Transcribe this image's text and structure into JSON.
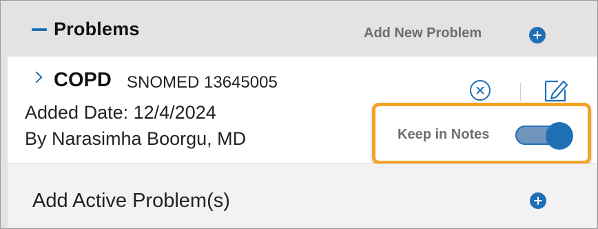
{
  "section": {
    "title": "Problems",
    "add_new_label": "Add New Problem"
  },
  "problem": {
    "name": "COPD",
    "code": "SNOMED 13645005",
    "added_date": "Added Date: 12/4/2024",
    "added_by": "By Narasimha Boorgu, MD",
    "keep_in_notes_label": "Keep in Notes",
    "keep_in_notes_enabled": true
  },
  "add_active": {
    "label": "Add Active Problem(s)"
  },
  "colors": {
    "accent": "#1f6fb5",
    "highlight": "#f4a328",
    "muted_text": "#6d6d6d"
  },
  "icons": [
    "collapse-icon",
    "add-circle-icon",
    "chevron-right-icon",
    "remove-circle-icon",
    "edit-icon"
  ]
}
